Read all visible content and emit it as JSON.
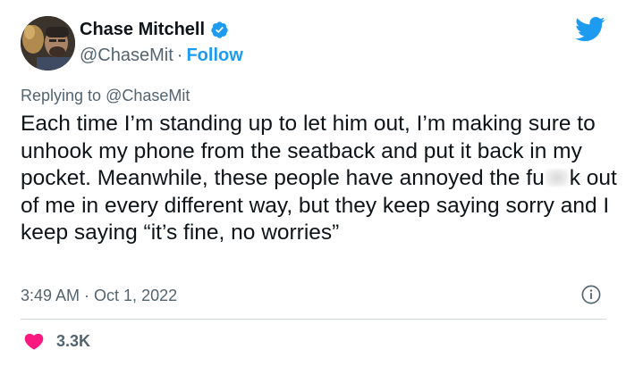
{
  "author": {
    "display_name": "Chase Mitchell",
    "handle": "@ChaseMit",
    "separator": "·",
    "follow_label": "Follow",
    "verified": true
  },
  "reply_context": {
    "prefix": "Replying to",
    "mention": "@ChaseMit"
  },
  "tweet": {
    "text_part1": "Each time I’m standing up to let him out, I’m making sure to unhook my phone from the seatback and put it back in my pocket. Meanwhile, these people have annoyed the fu",
    "text_part2": "k out of me in every different way, but they keep saying sorry and I keep saying “it’s fine, no worries”"
  },
  "meta": {
    "time": "3:49 AM",
    "separator": "·",
    "date": "Oct 1, 2022"
  },
  "engagement": {
    "likes": "3.3K"
  },
  "icons": {
    "brand": "twitter-bird-icon",
    "verified": "verified-badge-icon",
    "info": "info-icon",
    "like": "heart-icon"
  },
  "colors": {
    "accent": "#1d9bf0",
    "text_primary": "#0f1419",
    "text_secondary": "#536471",
    "like": "#f91880",
    "divider": "#cfd9de"
  }
}
